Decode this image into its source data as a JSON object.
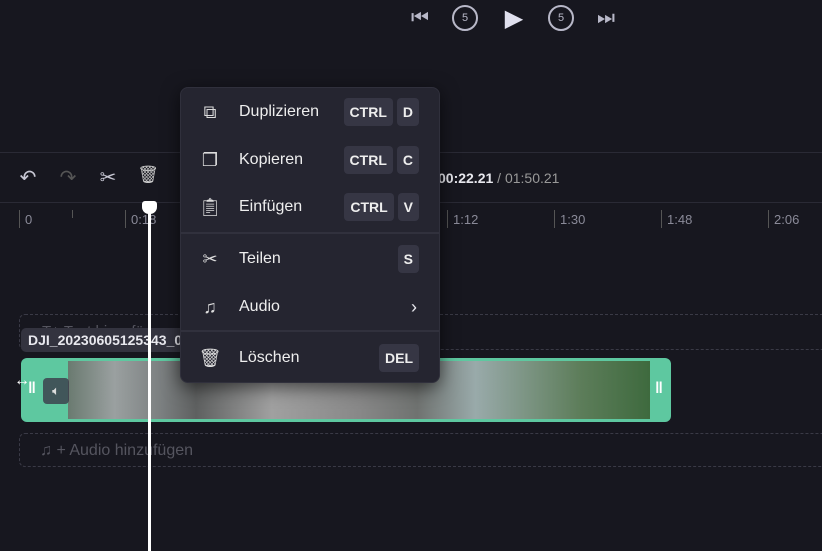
{
  "player": {
    "skip_back": "⏮",
    "rewind5": "5",
    "play": "▶",
    "forward5": "5",
    "skip_forward": "⏭"
  },
  "toolbar": {
    "undo": "↶",
    "redo": "↷",
    "cut": "✂",
    "delete": "🗑"
  },
  "time": {
    "current": "00:22.21",
    "separator": "/",
    "total": "01:50.21"
  },
  "ruler": [
    "0",
    "0:18",
    "1:12",
    "1:30",
    "1:48",
    "2:06"
  ],
  "context_menu": {
    "items": [
      {
        "label": "Duplizieren",
        "keys": [
          "CTRL",
          "D"
        ]
      },
      {
        "label": "Kopieren",
        "keys": [
          "CTRL",
          "C"
        ]
      },
      {
        "label": "Einfügen",
        "keys": [
          "CTRL",
          "V"
        ]
      },
      {
        "label": "Teilen",
        "keys": [
          "S"
        ]
      },
      {
        "label": "Audio",
        "submenu": "›"
      },
      {
        "label": "Löschen",
        "keys": [
          "DEL"
        ]
      }
    ]
  },
  "tracks": {
    "text_add": "T+ Text hinzufügen",
    "clip_name": "DJI_20230605125343_0",
    "audio_add": "+ Audio hinzufügen"
  },
  "colors": {
    "clip": "#5ec8a0",
    "bg": "#17171f",
    "menu": "#252530"
  }
}
